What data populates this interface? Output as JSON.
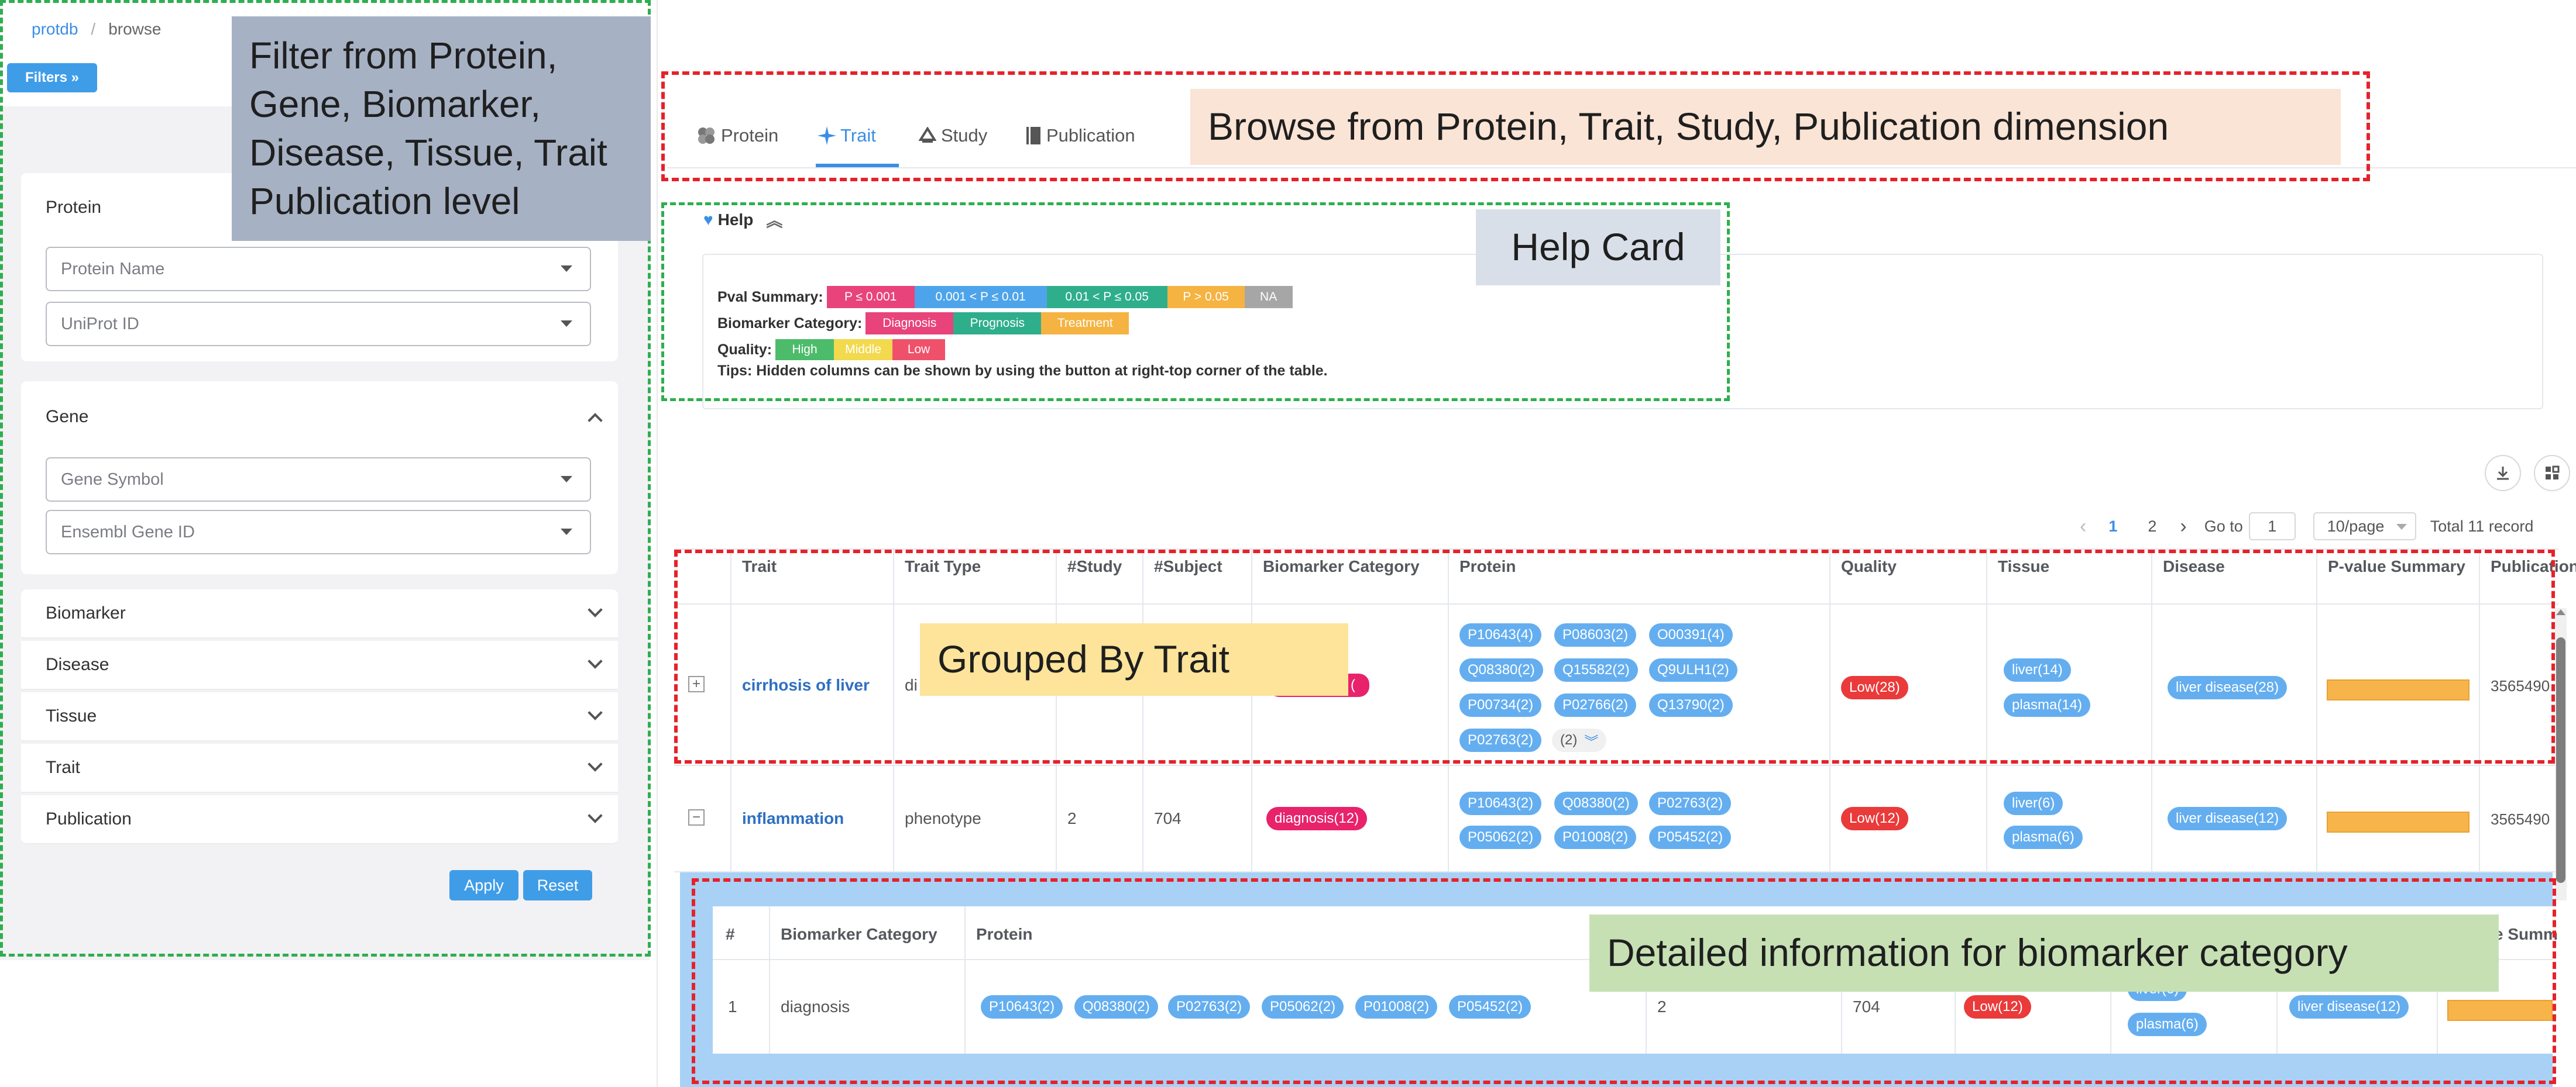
{
  "breadcrumb": {
    "root": "protdb",
    "sep": "/",
    "current": "browse"
  },
  "filters_button": "Filters »",
  "sidebar": {
    "protein_title": "Protein",
    "protein_fields": [
      "Protein Name",
      "UniProt ID"
    ],
    "gene_title": "Gene",
    "gene_fields": [
      "Gene Symbol",
      "Ensembl Gene ID"
    ],
    "collapsed": [
      "Biomarker",
      "Disease",
      "Tissue",
      "Trait",
      "Publication"
    ],
    "apply": "Apply",
    "reset": "Reset"
  },
  "tabs": [
    {
      "label": "Protein",
      "icon": "protein-icon"
    },
    {
      "label": "Trait",
      "icon": "trait-icon",
      "active": true
    },
    {
      "label": "Study",
      "icon": "study-icon"
    },
    {
      "label": "Publication",
      "icon": "publication-icon"
    }
  ],
  "help": {
    "title": "Help",
    "pval_label": "Pval Summary:",
    "pval_tags": [
      {
        "text": "P ≤ 0.001",
        "color": "#e8437a"
      },
      {
        "text": "0.001 < P ≤ 0.01",
        "color": "#4ea4ea"
      },
      {
        "text": "0.01 < P ≤ 0.05",
        "color": "#2fae8c"
      },
      {
        "text": "P > 0.05",
        "color": "#f5b342"
      },
      {
        "text": "NA",
        "color": "#a6a6a6"
      }
    ],
    "bio_label": "Biomarker Category:",
    "bio_tags": [
      {
        "text": "Diagnosis",
        "color": "#e8437a"
      },
      {
        "text": "Prognosis",
        "color": "#2fae8c"
      },
      {
        "text": "Treatment",
        "color": "#f5b342"
      }
    ],
    "quality_label": "Quality:",
    "quality_tags": [
      {
        "text": "High",
        "color": "#4cbc6b"
      },
      {
        "text": "Middle",
        "color": "#f2d94e"
      },
      {
        "text": "Low",
        "color": "#f0516a"
      }
    ],
    "tips": "Tips: Hidden columns can be shown by using the button at right-top corner of the table."
  },
  "pagination": {
    "pages": [
      "1",
      "2"
    ],
    "current": "1",
    "goto_label": "Go to",
    "goto_value": "1",
    "page_size": "10/page",
    "total": "Total 11 record"
  },
  "table": {
    "headers": [
      "Trait",
      "Trait Type",
      "#Study",
      "#Subject",
      "Biomarker Category",
      "Protein",
      "Quality",
      "Tissue",
      "Disease",
      "P-value Summary",
      "Publication"
    ],
    "rows": [
      {
        "expander": "+",
        "trait": "cirrhosis of liver",
        "trait_type": "di",
        "biomarker": "(",
        "proteins": [
          "P10643(4)",
          "P08603(2)",
          "O00391(4)",
          "Q08380(2)",
          "Q15582(2)",
          "Q9ULH1(2)",
          "P00734(2)",
          "P02766(2)",
          "Q13790(2)",
          "P02763(2)"
        ],
        "more": "(2)",
        "quality": "Low(28)",
        "tissue": [
          "liver(14)",
          "plasma(14)"
        ],
        "disease": "liver disease(28)",
        "publication": "3565490"
      },
      {
        "expander": "−",
        "trait": "inflammation",
        "trait_type": "phenotype",
        "study": "2",
        "subject": "704",
        "biomarker": "diagnosis(12)",
        "proteins": [
          "P10643(2)",
          "Q08380(2)",
          "P02763(2)",
          "P05062(2)",
          "P01008(2)",
          "P05452(2)"
        ],
        "quality": "Low(12)",
        "tissue": [
          "liver(6)",
          "plasma(6)"
        ],
        "disease": "liver disease(12)",
        "publication": "3565490"
      }
    ]
  },
  "subtable": {
    "headers": [
      "#",
      "Biomarker Category",
      "Protein",
      "e Summ"
    ],
    "row": {
      "index": "1",
      "category": "diagnosis",
      "proteins": [
        "P10643(2)",
        "Q08380(2)",
        "P02763(2)",
        "P05062(2)",
        "P01008(2)",
        "P05452(2)"
      ],
      "study": "2",
      "subject": "704",
      "quality": "Low(12)",
      "tissue": [
        "liver(6)",
        "plasma(6)"
      ],
      "disease": "liver disease(12)"
    }
  },
  "callouts": {
    "filter": "Filter from Protein, Gene, Biomarker, Disease, Tissue, Trait Publication level",
    "browse": "Browse from Protein, Trait, Study, Publication dimension",
    "help": "Help Card",
    "grouped": "Grouped By Trait",
    "detail": "Detailed information for biomarker category"
  }
}
